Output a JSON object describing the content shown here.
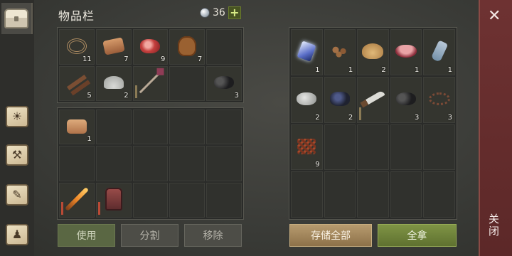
{
  "header": {
    "title": "物品栏",
    "gem_count": "36",
    "plus_label": "+"
  },
  "sidebar": {
    "items": [
      {
        "name": "inventory",
        "icon": "chest-icon",
        "active": true
      },
      {
        "name": "day-night",
        "icon": "sun-icon",
        "symbol": "☀"
      },
      {
        "name": "crafting",
        "icon": "hammer-icon",
        "symbol": "⚒"
      },
      {
        "name": "quests",
        "icon": "scroll-icon",
        "symbol": "✎"
      },
      {
        "name": "character",
        "icon": "backpack-icon",
        "symbol": "♟"
      }
    ]
  },
  "inventory_top": [
    {
      "icon": "rope-icon",
      "cls": "rope",
      "qty": "11"
    },
    {
      "icon": "leather-icon",
      "cls": "leather-roll",
      "qty": "7"
    },
    {
      "icon": "raw-meat-icon",
      "cls": "meat",
      "qty": "9"
    },
    {
      "icon": "animal-hide-icon",
      "cls": "hide",
      "qty": "7"
    },
    {
      "icon": "",
      "cls": "",
      "qty": ""
    },
    {
      "icon": "sticks-icon",
      "cls": "sticks",
      "qty": "5"
    },
    {
      "icon": "stone-dust-icon",
      "cls": "dust",
      "qty": "2"
    },
    {
      "icon": "spear-icon",
      "cls": "spear",
      "qty": "",
      "dur": "tan"
    },
    {
      "icon": "",
      "cls": "",
      "qty": ""
    },
    {
      "icon": "coal-icon",
      "cls": "coal",
      "qty": "3"
    }
  ],
  "inventory_bottom": [
    {
      "icon": "cloth-icon",
      "cls": "cloth",
      "qty": "1"
    },
    {
      "icon": "",
      "cls": "",
      "qty": ""
    },
    {
      "icon": "",
      "cls": "",
      "qty": ""
    },
    {
      "icon": "",
      "cls": "",
      "qty": ""
    },
    {
      "icon": "",
      "cls": "",
      "qty": ""
    },
    {
      "icon": "",
      "cls": "",
      "qty": ""
    },
    {
      "icon": "",
      "cls": "",
      "qty": ""
    },
    {
      "icon": "",
      "cls": "",
      "qty": ""
    },
    {
      "icon": "",
      "cls": "",
      "qty": ""
    },
    {
      "icon": "",
      "cls": "",
      "qty": ""
    },
    {
      "icon": "torch-icon",
      "cls": "torch",
      "qty": "",
      "dur": "red"
    },
    {
      "icon": "armor-icon",
      "cls": "armor",
      "qty": "",
      "dur": "red"
    },
    {
      "icon": "",
      "cls": "",
      "qty": ""
    },
    {
      "icon": "",
      "cls": "",
      "qty": ""
    },
    {
      "icon": "",
      "cls": "",
      "qty": ""
    }
  ],
  "storage": [
    {
      "icon": "crystal-icon",
      "cls": "crystal",
      "qty": "1"
    },
    {
      "icon": "seeds-icon",
      "cls": "seeds",
      "qty": "1"
    },
    {
      "icon": "grain-icon",
      "cls": "grain",
      "qty": "2"
    },
    {
      "icon": "berry-bowl-icon",
      "cls": "bowl",
      "qty": "1"
    },
    {
      "icon": "bottle-icon",
      "cls": "bottle",
      "qty": "1"
    },
    {
      "icon": "stone-icon",
      "cls": "stone",
      "qty": "2"
    },
    {
      "icon": "iron-ore-icon",
      "cls": "ore",
      "qty": "2"
    },
    {
      "icon": "machete-icon",
      "cls": "machete",
      "qty": "",
      "dur": "tan"
    },
    {
      "icon": "coal-icon",
      "cls": "coal",
      "qty": "3"
    },
    {
      "icon": "chain-icon",
      "cls": "chain",
      "qty": "3"
    },
    {
      "icon": "trap-icon",
      "cls": "trap",
      "qty": "9"
    },
    {
      "icon": "",
      "cls": "",
      "qty": ""
    },
    {
      "icon": "",
      "cls": "",
      "qty": ""
    },
    {
      "icon": "",
      "cls": "",
      "qty": ""
    },
    {
      "icon": "",
      "cls": "",
      "qty": ""
    },
    {
      "icon": "",
      "cls": "",
      "qty": ""
    },
    {
      "icon": "",
      "cls": "",
      "qty": ""
    },
    {
      "icon": "",
      "cls": "",
      "qty": ""
    },
    {
      "icon": "",
      "cls": "",
      "qty": ""
    },
    {
      "icon": "",
      "cls": "",
      "qty": ""
    }
  ],
  "buttons": {
    "use": "使用",
    "split": "分割",
    "remove": "移除",
    "store_all": "存储全部",
    "take_all": "全拿"
  },
  "close": {
    "label": "关闭",
    "x": "✕"
  },
  "colors": {
    "accent_green": "#7f9445",
    "accent_tan": "#b79b6f",
    "close_red": "#6e3232"
  }
}
